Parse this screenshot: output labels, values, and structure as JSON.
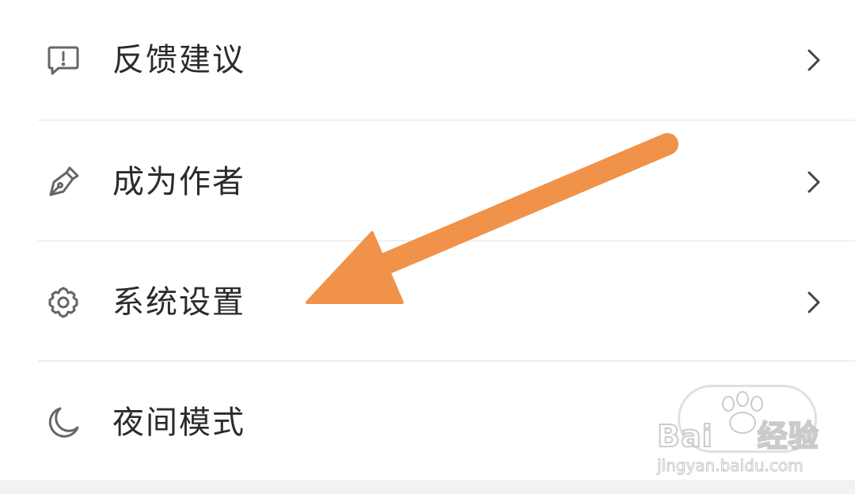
{
  "menu": {
    "items": [
      {
        "label": "反馈建议",
        "icon": "feedback-icon"
      },
      {
        "label": "成为作者",
        "icon": "pen-icon"
      },
      {
        "label": "系统设置",
        "icon": "gear-icon"
      },
      {
        "label": "夜间模式",
        "icon": "moon-icon"
      }
    ]
  },
  "overlay": {
    "arrow_color": "#F0924A"
  },
  "watermark": {
    "brand_left": "Bai",
    "brand_right": "经验",
    "url": "jingyan.baidu.com"
  },
  "colors": {
    "text": "#2b2b2b",
    "icon": "#666666",
    "divider": "#f0f0f0",
    "bottom_band": "#f2f2f2"
  }
}
